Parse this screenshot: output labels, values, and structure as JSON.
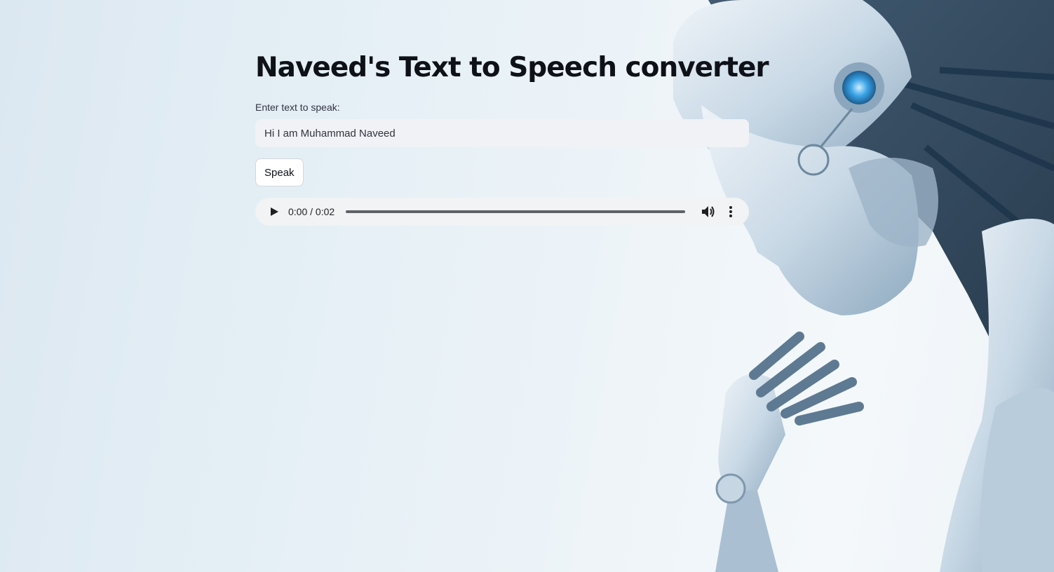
{
  "app": {
    "title": "Naveed's Text to Speech converter"
  },
  "form": {
    "input_label": "Enter text to speak:",
    "input_value": "Hi I am Muhammad Naveed",
    "speak_label": "Speak"
  },
  "audio": {
    "time": "0:00 / 0:02",
    "progress": 0
  },
  "colors": {
    "accent": "#0e1117",
    "input_bg": "#f0f2f6",
    "player_bg": "#f1f3f4"
  },
  "icons": [
    "play-icon",
    "volume-icon",
    "more-options-icon",
    "robot-illustration"
  ]
}
